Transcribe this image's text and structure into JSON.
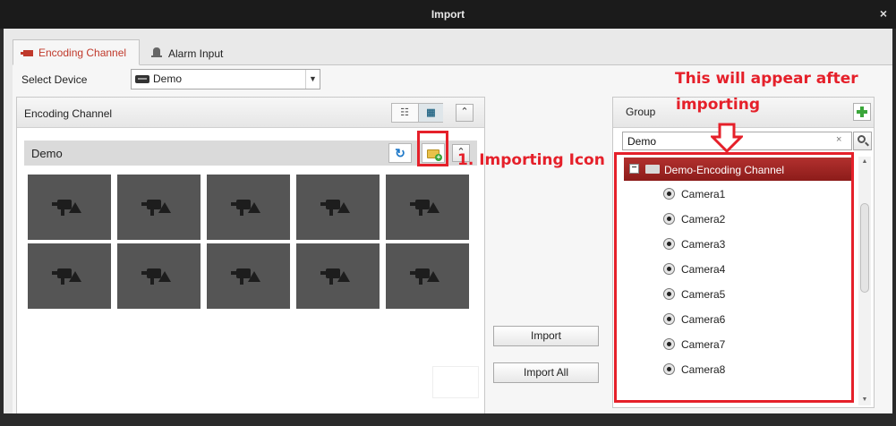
{
  "window": {
    "title": "Import",
    "close_glyph": "×"
  },
  "tabs": [
    {
      "label": "Encoding Channel",
      "icon": "camera-icon"
    },
    {
      "label": "Alarm Input",
      "icon": "alarm-icon"
    }
  ],
  "device": {
    "label": "Select Device",
    "selected": "Demo",
    "arrow": "▼"
  },
  "left_panel": {
    "title": "Encoding Channel",
    "view_list_glyph": "☷",
    "view_grid_glyph": "▦",
    "collapse_glyph": "⌃",
    "group_name": "Demo",
    "refresh_glyph": "↻",
    "channel_count": 10
  },
  "annotations": {
    "importing_icon": "1. Importing Icon",
    "appear_line1": "This will appear after",
    "appear_line2": "importing"
  },
  "buttons": {
    "import": "Import",
    "import_all": "Import All"
  },
  "right_panel": {
    "title": "Group",
    "search_value": "Demo",
    "search_clear": "×",
    "tree": {
      "root_toggle": "−",
      "root": "Demo-Encoding Channel",
      "items": [
        "Camera1",
        "Camera2",
        "Camera3",
        "Camera4",
        "Camera5",
        "Camera6",
        "Camera7",
        "Camera8"
      ]
    },
    "scroll_up": "▲",
    "scroll_down": "▼"
  },
  "colors": {
    "accent_red": "#e5202a",
    "tree_root": "#a02624",
    "tile": "#555555"
  }
}
